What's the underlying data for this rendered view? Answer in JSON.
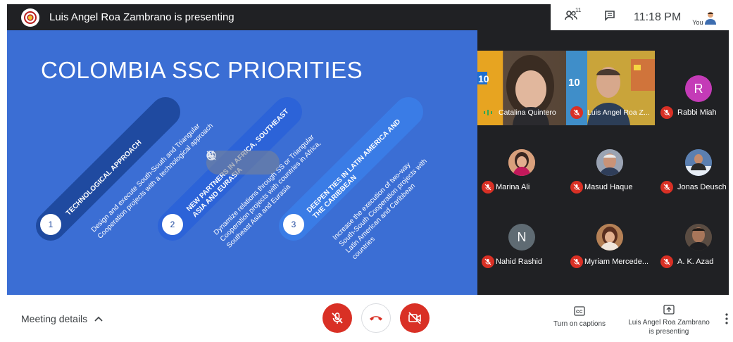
{
  "topbar": {
    "presenter_title": "Luis Angel Roa Zambrano is presenting",
    "logo_icon": "colombia-seal-icon"
  },
  "status": {
    "participants_count": "11",
    "time": "11:18 PM",
    "you_label": "You"
  },
  "slide": {
    "title": "COLOMBIA SSC PRIORITIES",
    "items": [
      {
        "number": "1",
        "heading": "TECHNOLOGICAL APPROACH",
        "desc_lines": [
          "Design and execute South-South and Triangular",
          "Cooperation projects with a technological approach"
        ]
      },
      {
        "number": "2",
        "heading_lines": [
          "NEW PARTNERS IN AFRICA, SOUTHEAST",
          "ASIA AND EURASIA"
        ],
        "desc_lines": [
          "Dynamize relations through SS or Triangular",
          "Cooperation projects with countries in Africa,",
          "Southeast Asia and Eurasia"
        ]
      },
      {
        "number": "3",
        "heading_lines": [
          "DEEPEN TIES IN LATIN AMERICA AND",
          "THE CARIBBEAN"
        ],
        "desc_lines": [
          "Increase the execution of two-way",
          "South-South Cooperation projects with",
          "Latin American and Caribbean",
          "countries"
        ]
      }
    ]
  },
  "participants": [
    {
      "name": "Catalina Quintero",
      "muted": false,
      "kind": "video"
    },
    {
      "name": "Luis Angel Roa Z...",
      "muted": true,
      "kind": "video"
    },
    {
      "name": "Rabbi Miah",
      "muted": true,
      "kind": "initial",
      "initial": "R",
      "color": "#c43bb7"
    },
    {
      "name": "Marina Ali",
      "muted": true,
      "kind": "photo",
      "color": "#c98a6a"
    },
    {
      "name": "Masud Haque",
      "muted": true,
      "kind": "photo",
      "color": "#8f98a8"
    },
    {
      "name": "Jonas Deusch",
      "muted": true,
      "kind": "photo",
      "color": "#3f6fa8"
    },
    {
      "name": "Nahid Rashid",
      "muted": true,
      "kind": "initial",
      "initial": "N",
      "color": "#5f6b73"
    },
    {
      "name": "Myriam Mercede...",
      "muted": true,
      "kind": "photo",
      "color": "#a7734e"
    },
    {
      "name": "A. K. Azad",
      "muted": true,
      "kind": "photo",
      "color": "#4a3d35"
    }
  ],
  "bottom": {
    "meeting_details": "Meeting details",
    "captions_label": "Turn on captions",
    "presenting_line1": "Luis Angel Roa Zambrano",
    "presenting_line2": "is presenting",
    "cc_text": "CC"
  },
  "colors": {
    "danger": "#d93025",
    "slide_bg": "#3b6ed4",
    "dark": "#202124"
  }
}
